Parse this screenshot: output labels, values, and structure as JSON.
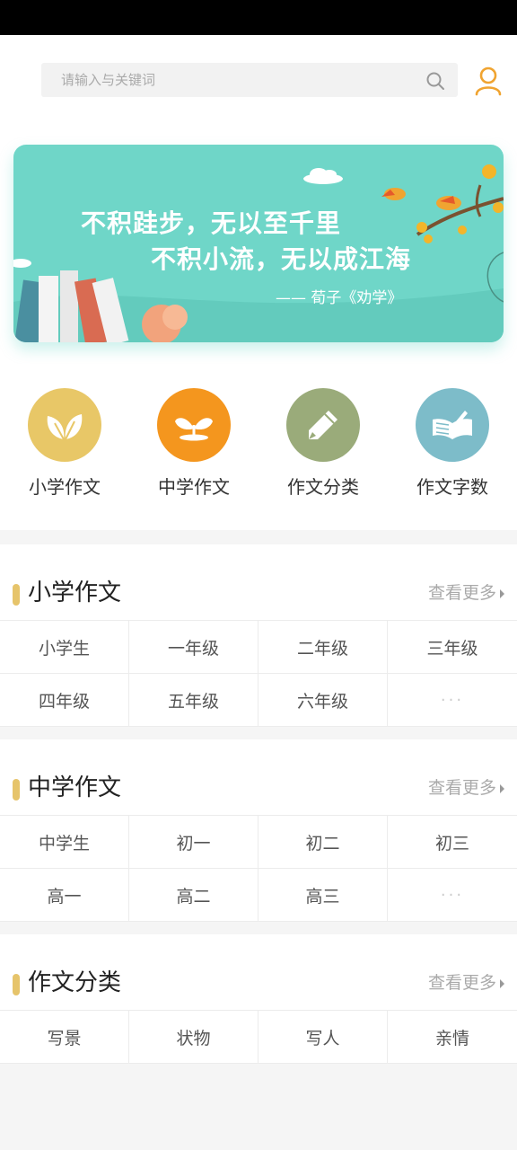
{
  "search": {
    "placeholder": "请输入与关键词",
    "icon": "search-icon"
  },
  "header": {
    "user_icon": "user-icon",
    "accent": "#f0a431"
  },
  "banner": {
    "line1": "不积跬步，无以至千里",
    "line2": "不积小流，无以成江海",
    "line3": "——  荀子《劝学》",
    "bg": "#6fd6c8"
  },
  "categories": [
    {
      "label": "小学作文",
      "icon": "leaf-icon",
      "color": "#e8c767"
    },
    {
      "label": "中学作文",
      "icon": "sprout-icon",
      "color": "#f4961e"
    },
    {
      "label": "作文分类",
      "icon": "pencil-icon",
      "color": "#9aab7a"
    },
    {
      "label": "作文字数",
      "icon": "book-icon",
      "color": "#7dbcc9"
    }
  ],
  "sections": [
    {
      "title": "小学作文",
      "more": "查看更多",
      "items": [
        "小学生",
        "一年级",
        "二年级",
        "三年级",
        "四年级",
        "五年级",
        "六年级",
        "···"
      ]
    },
    {
      "title": "中学作文",
      "more": "查看更多",
      "items": [
        "中学生",
        "初一",
        "初二",
        "初三",
        "高一",
        "高二",
        "高三",
        "···"
      ]
    },
    {
      "title": "作文分类",
      "more": "查看更多",
      "items": [
        "写景",
        "状物",
        "写人",
        "亲情"
      ]
    }
  ]
}
